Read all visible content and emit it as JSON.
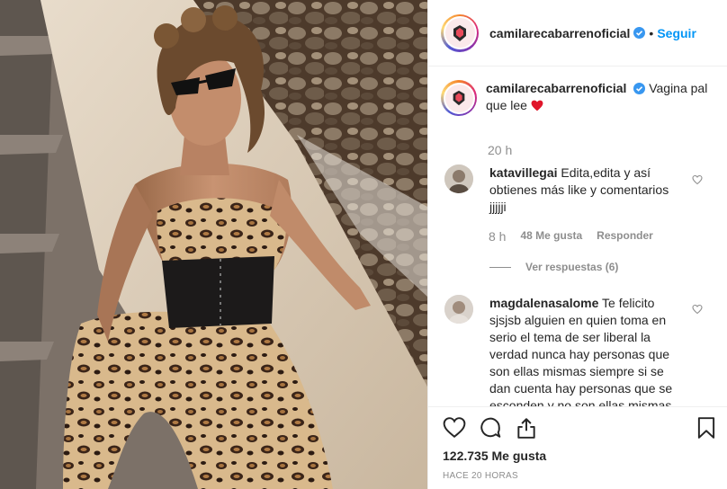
{
  "header": {
    "username": "camilarecabarrenoficial",
    "separator": "•",
    "follow_label": "Seguir"
  },
  "caption": {
    "username": "camilarecabarrenoficial",
    "text": "Vagina pal que lee",
    "time": "20 h"
  },
  "comments": [
    {
      "username": "katavillegai",
      "text": "Edita,edita y así obtienes más like y comentarios jjjjji",
      "time": "8 h",
      "likes": "48 Me gusta",
      "reply_label": "Responder",
      "view_replies": "Ver respuestas (6)"
    },
    {
      "username": "magdalenasalome",
      "text": "Te felicito sjsjsb alguien en quien toma en serio el tema de ser liberal la verdad nunca hay personas que son ellas mismas siempre si se dan cuenta hay personas que se esconden y no son ellas mismas"
    }
  ],
  "footer": {
    "likes": "122.735 Me gusta",
    "posted": "HACE 20 HORAS"
  },
  "colors": {
    "link_blue": "#0095f6",
    "verified_blue": "#3897f0",
    "heart_red": "#ed4956",
    "muted": "#8e8e8e"
  },
  "icons": [
    "verified-icon",
    "red-heart-emoji",
    "like-heart-icon",
    "comment-icon",
    "share-icon",
    "bookmark-icon"
  ]
}
